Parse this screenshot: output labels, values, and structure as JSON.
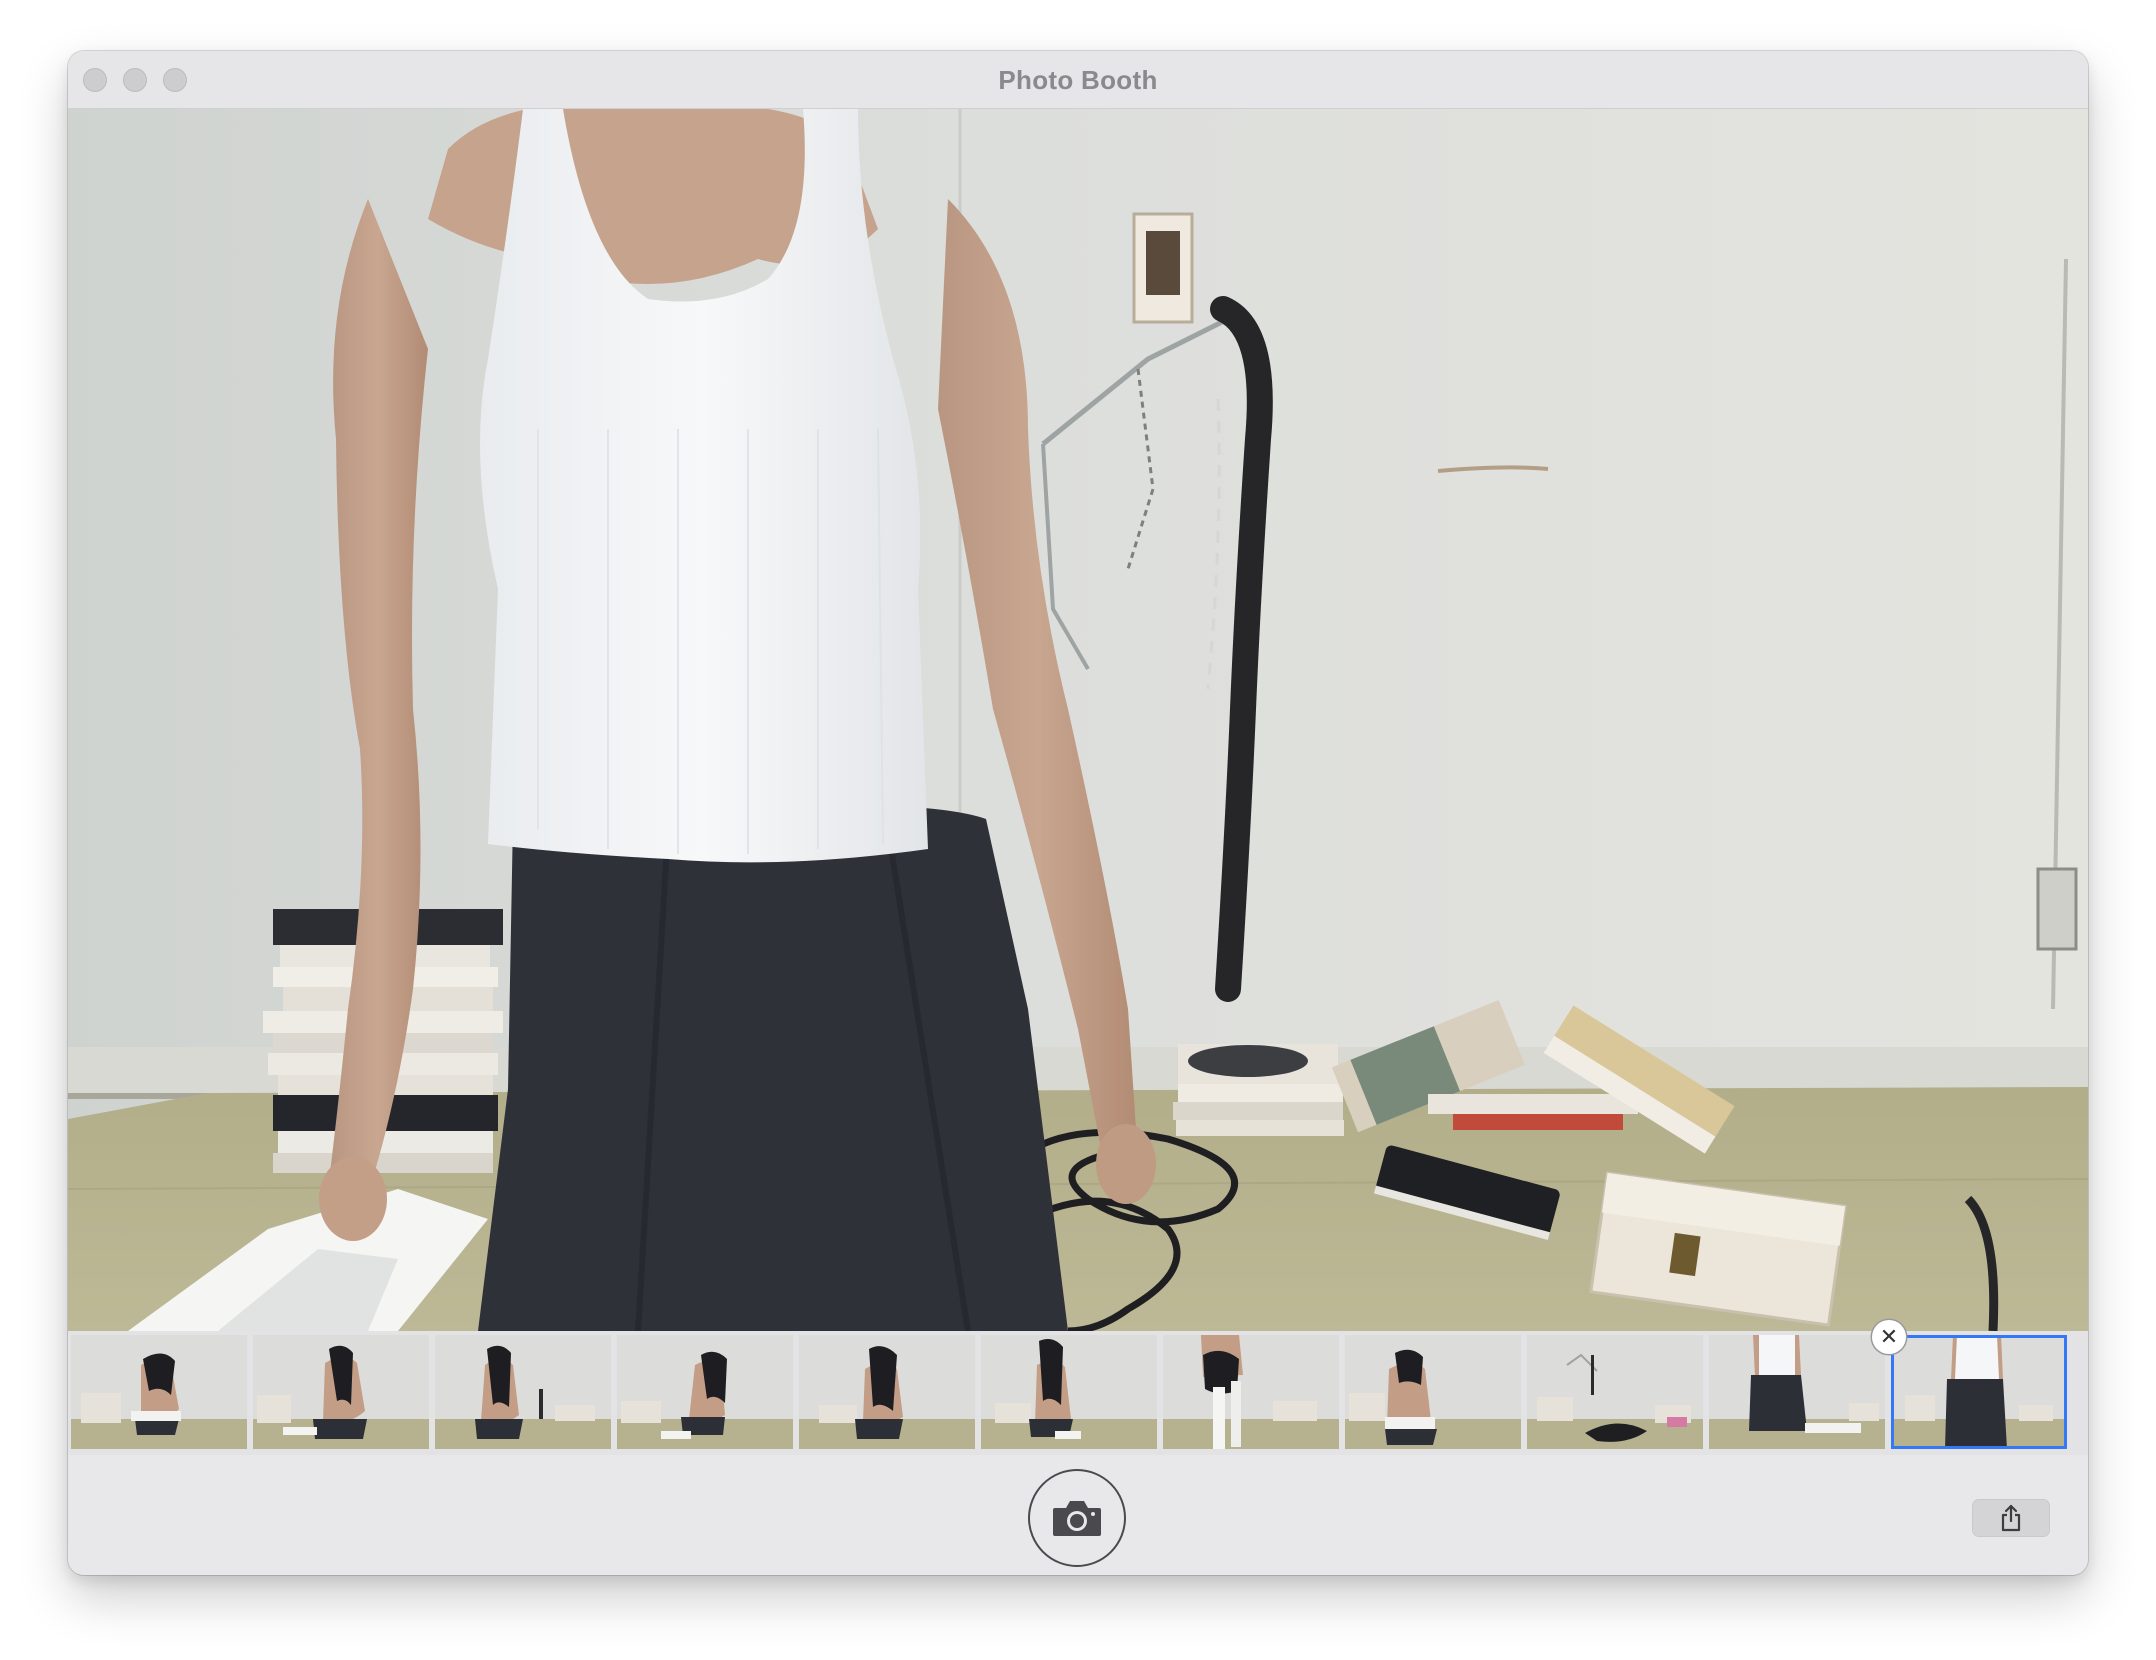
{
  "window": {
    "title": "Photo Booth"
  },
  "titlebar": {
    "buttons": [
      "close",
      "minimize",
      "zoom"
    ]
  },
  "preview": {
    "icon": "live-camera-preview"
  },
  "thumbnails": {
    "count": 11,
    "selected_index": 10,
    "delete_icon": "close-circle-icon",
    "delete_glyph": "✕"
  },
  "toolbar": {
    "shutter_icon": "camera-icon",
    "share_icon": "share-icon"
  },
  "colors": {
    "selection": "#3478f6",
    "window": "#e8e8ea"
  }
}
